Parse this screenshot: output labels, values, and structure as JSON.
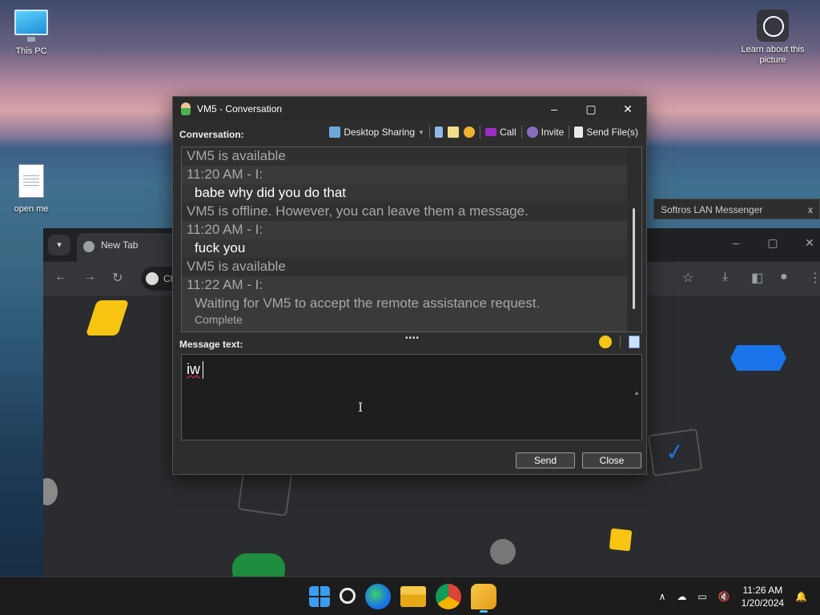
{
  "desktop": {
    "icons": [
      {
        "label": "This PC"
      },
      {
        "label": "open me"
      }
    ],
    "learn_label": "Learn about this picture"
  },
  "chrome": {
    "tab_label": "New Tab",
    "omnibox_text": "Ch"
  },
  "softros": {
    "title": "Softros LAN Messenger",
    "close": "x"
  },
  "conversation": {
    "title": "VM5 - Conversation",
    "toolbar_label": "Conversation:",
    "desktop_sharing": "Desktop Sharing",
    "call": "Call",
    "invite": "Invite",
    "send_files": "Send File(s)",
    "history": [
      {
        "kind": "status",
        "text": "VM5 is available"
      },
      {
        "kind": "time",
        "text": "11:20 AM - I:"
      },
      {
        "kind": "msg",
        "text": "babe why did you do that"
      },
      {
        "kind": "status",
        "text": "VM5 is offline. However, you can leave them a message."
      },
      {
        "kind": "time",
        "text": "11:20 AM - I:"
      },
      {
        "kind": "msg",
        "text": "fuck you"
      },
      {
        "kind": "status",
        "text": "VM5 is available"
      },
      {
        "kind": "time",
        "text": "11:22 AM - I:"
      },
      {
        "kind": "sys",
        "text": "Waiting for VM5 to accept the remote assistance request."
      },
      {
        "kind": "sub",
        "text": "Complete"
      }
    ],
    "message_label": "Message text:",
    "message_value": "iw",
    "send": "Send",
    "close": "Close"
  },
  "taskbar": {
    "time": "11:26 AM",
    "date": "1/20/2024"
  },
  "colors": {
    "accent": "#4cc2ff",
    "window_bg": "#2d2d2d",
    "history_bg": "#3a3a3a"
  }
}
